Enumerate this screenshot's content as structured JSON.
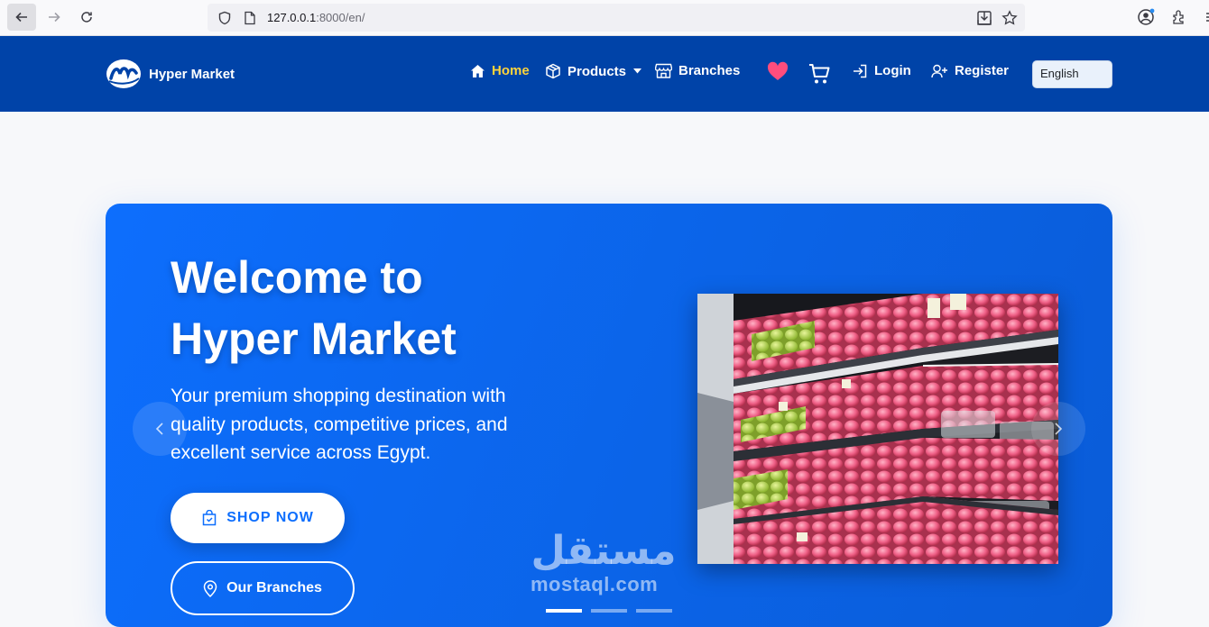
{
  "browser": {
    "url_host": "127.0.0.1",
    "url_path": ":8000/en/"
  },
  "header": {
    "logo_text": "Hyper Market",
    "nav": {
      "home": "Home",
      "products": "Products",
      "branches": "Branches",
      "login": "Login",
      "register": "Register"
    },
    "language": "English",
    "colors": {
      "bg": "#0043a8",
      "active": "#ffd43b",
      "heart": "#ff4d7d"
    }
  },
  "hero": {
    "title_line1": "Welcome to",
    "title_line2": "Hyper Market",
    "subtitle": "Your premium shopping destination with quality products, competitive prices, and excellent service across Egypt.",
    "shop_button": "SHOP NOW",
    "branches_button": "Our Branches",
    "slides_count": 3,
    "active_slide": 1,
    "color": "#0d6efd"
  },
  "watermark": {
    "arabic": "مستقل",
    "latin": "mostaql.com"
  }
}
